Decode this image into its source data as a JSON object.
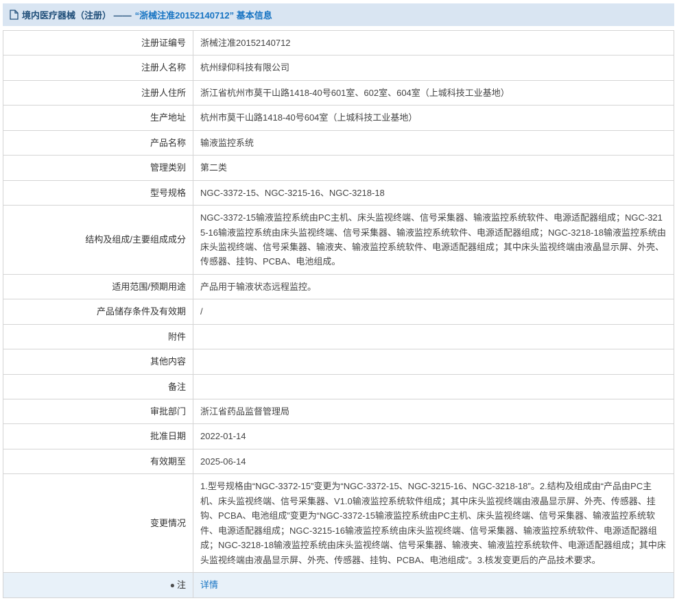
{
  "header": {
    "title_prefix": "境内医疗器械（注册） ——",
    "title_highlight": "“浙械注准20152140712” 基本信息",
    "accent_color": "#1673c2",
    "bar_color": "#d9e5f2"
  },
  "table": {
    "rows": [
      {
        "label": "注册证编号",
        "value": "浙械注准20152140712"
      },
      {
        "label": "注册人名称",
        "value": "杭州绿仰科技有限公司"
      },
      {
        "label": "注册人住所",
        "value": "浙江省杭州市莫干山路1418-40号601室、602室、604室（上城科技工业基地）"
      },
      {
        "label": "生产地址",
        "value": "杭州市莫干山路1418-40号604室（上城科技工业基地）"
      },
      {
        "label": "产品名称",
        "value": "输液监控系统"
      },
      {
        "label": "管理类别",
        "value": "第二类"
      },
      {
        "label": "型号规格",
        "value": "NGC-3372-15、NGC-3215-16、NGC-3218-18"
      },
      {
        "label": "结构及组成/主要组成成分",
        "value": "NGC-3372-15输液监控系统由PC主机、床头监视终端、信号采集器、输液监控系统软件、电源适配器组成；NGC-3215-16输液监控系统由床头监视终端、信号采集器、输液监控系统软件、电源适配器组成；NGC-3218-18输液监控系统由床头监视终端、信号采集器、输液夹、输液监控系统软件、电源适配器组成；其中床头监视终端由液晶显示屏、外壳、传感器、挂钩、PCBA、电池组成。"
      },
      {
        "label": "适用范围/预期用途",
        "value": "产品用于输液状态远程监控。"
      },
      {
        "label": "产品储存条件及有效期",
        "value": "/"
      },
      {
        "label": "附件",
        "value": ""
      },
      {
        "label": "其他内容",
        "value": ""
      },
      {
        "label": "备注",
        "value": ""
      },
      {
        "label": "审批部门",
        "value": "浙江省药品监督管理局"
      },
      {
        "label": "批准日期",
        "value": "2022-01-14"
      },
      {
        "label": "有效期至",
        "value": "2025-06-14"
      },
      {
        "label": "变更情况",
        "value": "1.型号规格由“NGC-3372-15”变更为“NGC-3372-15、NGC-3215-16、NGC-3218-18”。2.结构及组成由“产品由PC主机、床头监视终端、信号采集器、V1.0输液监控系统软件组成；其中床头监视终端由液晶显示屏、外壳、传感器、挂钩、PCBA、电池组成”变更为“NGC-3372-15输液监控系统由PC主机、床头监视终端、信号采集器、输液监控系统软件、电源适配器组成；NGC-3215-16输液监控系统由床头监视终端、信号采集器、输液监控系统软件、电源适配器组成；NGC-3218-18输液监控系统由床头监视终端、信号采集器、输液夹、输液监控系统软件、电源适配器组成；其中床头监视终端由液晶显示屏、外壳、传感器、挂钩、PCBA、电池组成”。3.核发变更后的产品技术要求。"
      }
    ]
  },
  "note": {
    "icon": "note-bullet-icon",
    "label": "注",
    "link_label": "详情"
  }
}
